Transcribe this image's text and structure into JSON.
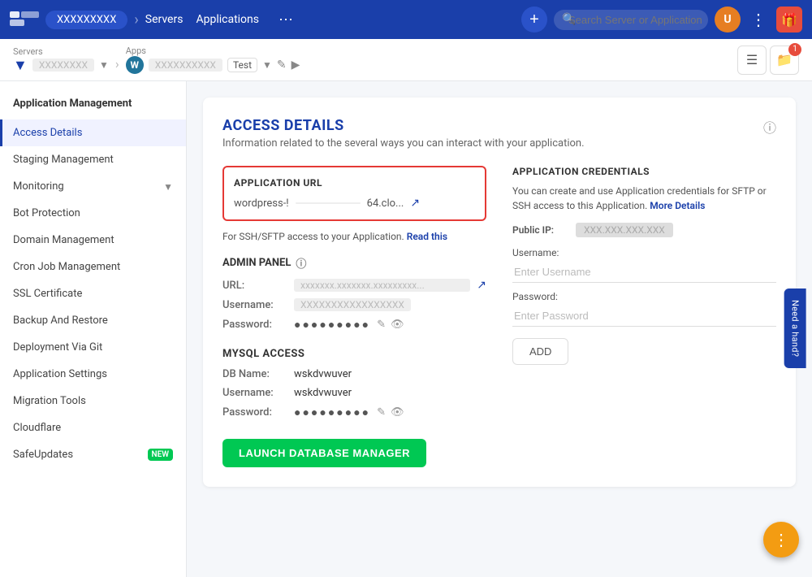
{
  "topnav": {
    "brand": "XXXXXXXXX",
    "links": [
      {
        "label": "Servers",
        "active": false
      },
      {
        "label": "Applications",
        "active": false
      }
    ],
    "plus_label": "+",
    "search_placeholder": "Search Server or Application",
    "avatar_initials": "U",
    "help_label": "Need a hand?"
  },
  "breadcrumb": {
    "servers_label": "Servers",
    "server_name": "XXXXXXXX",
    "apps_label": "Apps",
    "app_name": "XXXXXXXXXX",
    "app_tag": "Test",
    "files_count": "1"
  },
  "sidebar": {
    "title": "Application Management",
    "items": [
      {
        "label": "Access Details",
        "active": true
      },
      {
        "label": "Staging Management",
        "active": false
      },
      {
        "label": "Monitoring",
        "active": false,
        "has_arrow": true
      },
      {
        "label": "Bot Protection",
        "active": false
      },
      {
        "label": "Domain Management",
        "active": false
      },
      {
        "label": "Cron Job Management",
        "active": false
      },
      {
        "label": "SSL Certificate",
        "active": false
      },
      {
        "label": "Backup And Restore",
        "active": false
      },
      {
        "label": "Deployment Via Git",
        "active": false
      },
      {
        "label": "Application Settings",
        "active": false
      },
      {
        "label": "Migration Tools",
        "active": false
      },
      {
        "label": "Cloudflare",
        "active": false
      },
      {
        "label": "SafeUpdates",
        "active": false,
        "badge": "NEW"
      }
    ]
  },
  "main": {
    "title": "ACCESS DETAILS",
    "subtitle": "Information related to the several ways you can interact with your application.",
    "app_url_section": {
      "label": "APPLICATION URL",
      "url_prefix": "wordpress-!",
      "url_suffix": "64.clo...",
      "ssh_note": "For SSH/SFTP access to your Application.",
      "read_this_label": "Read this"
    },
    "admin_panel": {
      "label": "ADMIN PANEL",
      "url_label": "URL:",
      "url_value": "xxxxxxx.xxxxxxx.xxxxxxxxx...",
      "username_label": "Username:",
      "username_value": "XXXXXXXXXXXXXXXXX",
      "password_label": "Password:",
      "password_dots": "●●●●●●●●●"
    },
    "mysql": {
      "label": "MYSQL ACCESS",
      "db_name_label": "DB Name:",
      "db_name_value": "wskdvwuver",
      "username_label": "Username:",
      "username_value": "wskdvwuver",
      "password_label": "Password:",
      "password_dots": "●●●●●●●●●"
    },
    "launch_btn_label": "LAUNCH DATABASE MANAGER",
    "app_credentials": {
      "title": "APPLICATION CREDENTIALS",
      "desc": "You can create and use Application credentials for SFTP or SSH access to this Application.",
      "more_details_label": "More Details",
      "public_ip_label": "Public IP:",
      "public_ip_value": "XXX.XXX.XXX.XXX",
      "username_placeholder": "Enter Username",
      "password_placeholder": "Enter Password",
      "add_btn_label": "ADD"
    }
  },
  "fab": {
    "icon": "⊞"
  }
}
